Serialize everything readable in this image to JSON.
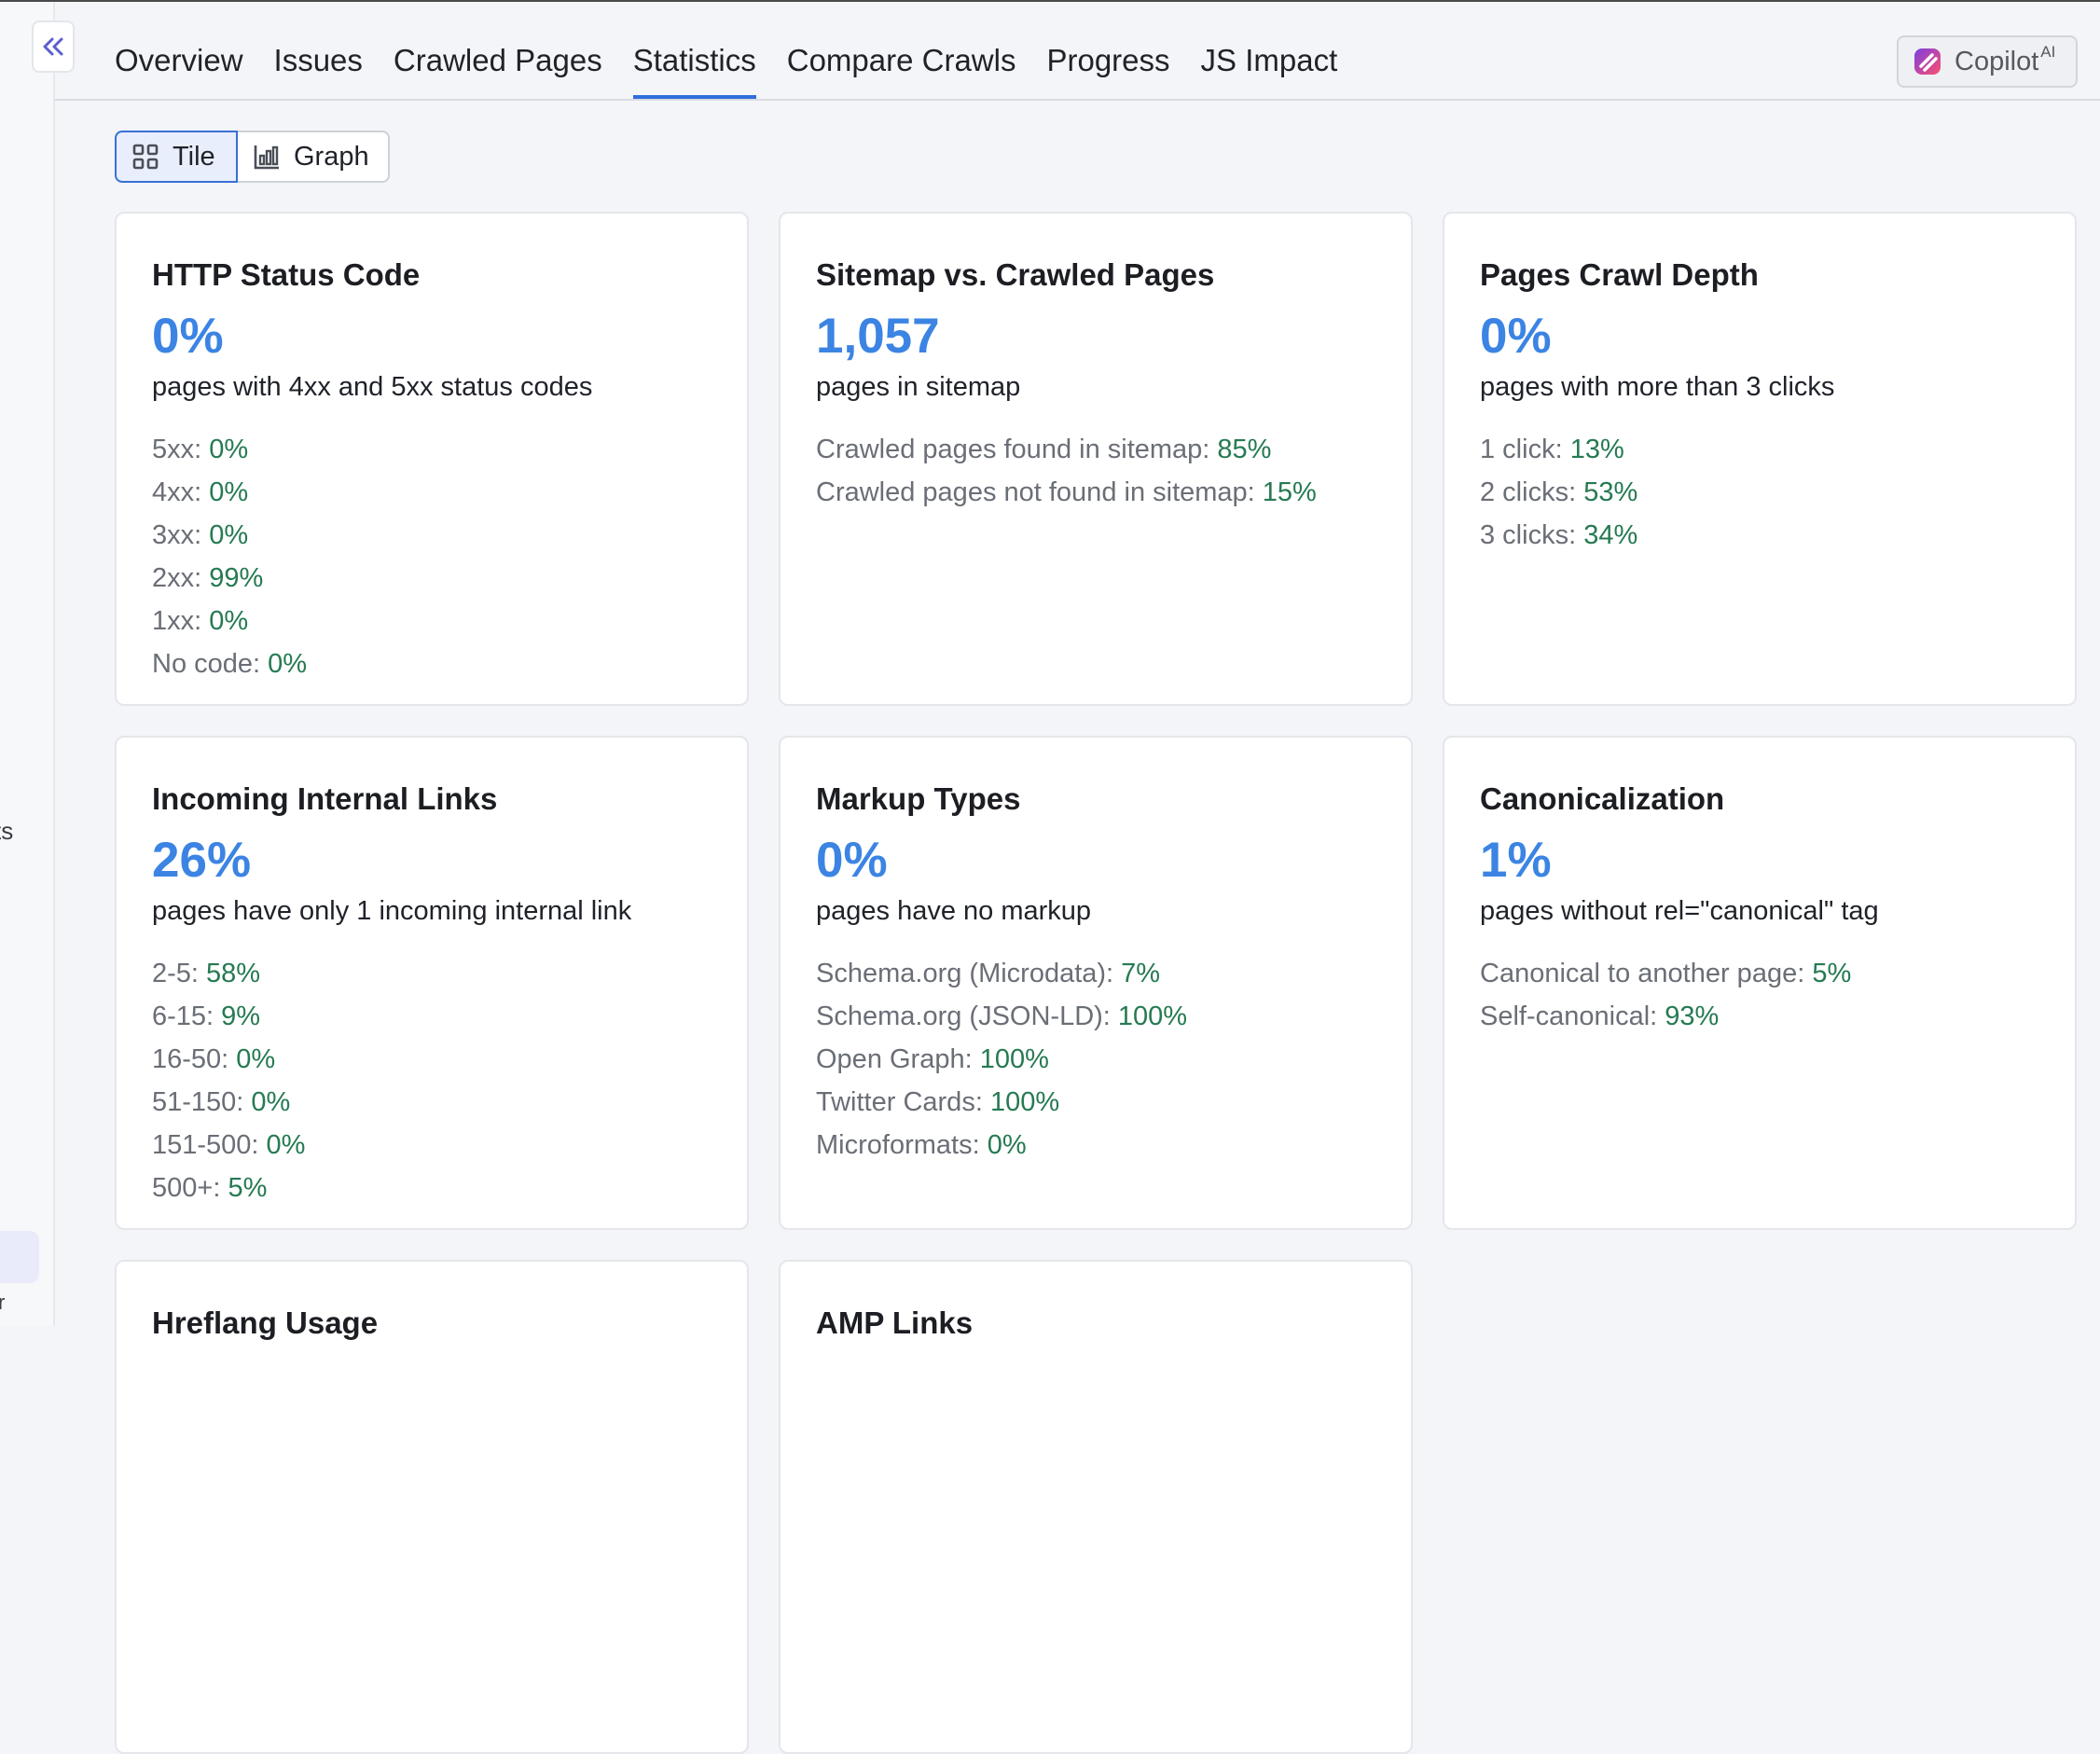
{
  "tabs": [
    {
      "label": "Overview",
      "active": false
    },
    {
      "label": "Issues",
      "active": false
    },
    {
      "label": "Crawled Pages",
      "active": false
    },
    {
      "label": "Statistics",
      "active": true
    },
    {
      "label": "Compare Crawls",
      "active": false
    },
    {
      "label": "Progress",
      "active": false
    },
    {
      "label": "JS Impact",
      "active": false
    }
  ],
  "copilot": {
    "label": "Copilot",
    "superscript": "AI"
  },
  "view_toggle": {
    "tile_label": "Tile",
    "graph_label": "Graph",
    "selected": "Tile"
  },
  "sidebar": {
    "partial_label": "ts",
    "partial_mark": "r"
  },
  "colors": {
    "accent": "#2f6fdc",
    "big_number": "#3c84e3",
    "value_green": "#267a52"
  },
  "cards": [
    {
      "title": "HTTP Status Code",
      "big": "0%",
      "desc": "pages with 4xx and 5xx status codes",
      "rows": [
        {
          "label": "5xx: ",
          "value": "0%"
        },
        {
          "label": "4xx: ",
          "value": "0%"
        },
        {
          "label": "3xx: ",
          "value": "0%"
        },
        {
          "label": "2xx: ",
          "value": "99%"
        },
        {
          "label": "1xx: ",
          "value": "0%"
        },
        {
          "label": "No code: ",
          "value": "0%"
        }
      ]
    },
    {
      "title": "Sitemap vs. Crawled Pages",
      "big": "1,057",
      "desc": "pages in sitemap",
      "rows": [
        {
          "label": "Crawled pages found in sitemap: ",
          "value": "85%"
        },
        {
          "label": "Crawled pages not found in sitemap: ",
          "value": "15%"
        }
      ]
    },
    {
      "title": "Pages Crawl Depth",
      "big": "0%",
      "desc": "pages with more than 3 clicks",
      "rows": [
        {
          "label": "1 click: ",
          "value": "13%"
        },
        {
          "label": "2 clicks: ",
          "value": "53%"
        },
        {
          "label": "3 clicks: ",
          "value": "34%"
        }
      ]
    },
    {
      "title": "Incoming Internal Links",
      "big": "26%",
      "desc": "pages have only 1 incoming internal link",
      "rows": [
        {
          "label": "2-5: ",
          "value": "58%"
        },
        {
          "label": "6-15: ",
          "value": "9%"
        },
        {
          "label": "16-50: ",
          "value": "0%"
        },
        {
          "label": "51-150: ",
          "value": "0%"
        },
        {
          "label": "151-500: ",
          "value": "0%"
        },
        {
          "label": "500+: ",
          "value": "5%"
        }
      ]
    },
    {
      "title": "Markup Types",
      "big": "0%",
      "desc": "pages have no markup",
      "rows": [
        {
          "label": "Schema.org (Microdata): ",
          "value": "7%"
        },
        {
          "label": "Schema.org (JSON-LD): ",
          "value": "100%"
        },
        {
          "label": "Open Graph: ",
          "value": "100%"
        },
        {
          "label": "Twitter Cards: ",
          "value": "100%"
        },
        {
          "label": "Microformats: ",
          "value": "0%"
        }
      ]
    },
    {
      "title": "Canonicalization",
      "big": "1%",
      "desc": "pages without rel=\"canonical\" tag",
      "rows": [
        {
          "label": "Canonical to another page: ",
          "value": "5%"
        },
        {
          "label": "Self-canonical: ",
          "value": "93%"
        }
      ]
    },
    {
      "title": "Hreflang Usage",
      "big": "",
      "desc": "",
      "rows": []
    },
    {
      "title": "AMP Links",
      "big": "",
      "desc": "",
      "rows": []
    }
  ]
}
